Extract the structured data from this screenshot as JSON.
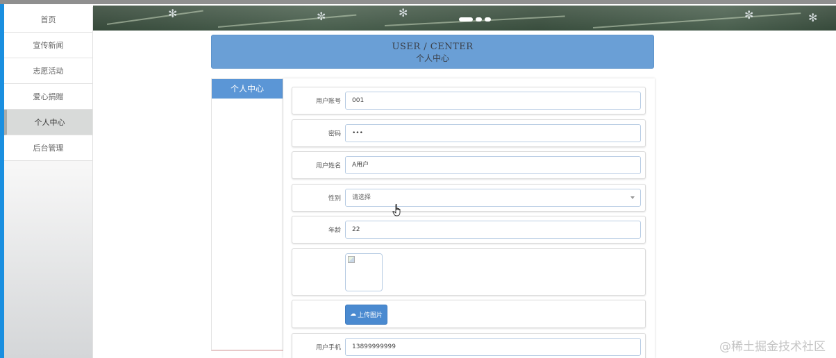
{
  "sidebar": {
    "items": [
      {
        "label": "首页"
      },
      {
        "label": "宣传新闻"
      },
      {
        "label": "志愿活动"
      },
      {
        "label": "爱心捐赠"
      },
      {
        "label": "个人中心",
        "active": true
      },
      {
        "label": "后台管理"
      }
    ]
  },
  "banner": {
    "slides": 3,
    "active_slide": 1
  },
  "header": {
    "title": "USER / CENTER",
    "subtitle": "个人中心"
  },
  "left_panel": {
    "title": "个人中心"
  },
  "form": {
    "account_label": "用户账号",
    "account_value": "001",
    "password_label": "密码",
    "password_value": "•••",
    "name_label": "用户姓名",
    "name_value": "A用户",
    "gender_label": "性别",
    "gender_value": "请选择",
    "age_label": "年龄",
    "age_value": "22",
    "upload_label": "上传图片",
    "phone_label": "用户手机",
    "phone_value": "13899999999"
  },
  "icons": {
    "upload": "cloud-upload-icon",
    "cursor": "hand-pointer-icon",
    "dropdown": "chevron-down-icon"
  },
  "colors": {
    "header_bg": "#6a9fd6",
    "accent": "#5b96d6",
    "left_edge": "#1a8fe0"
  },
  "watermark": "@稀土掘金技术社区"
}
